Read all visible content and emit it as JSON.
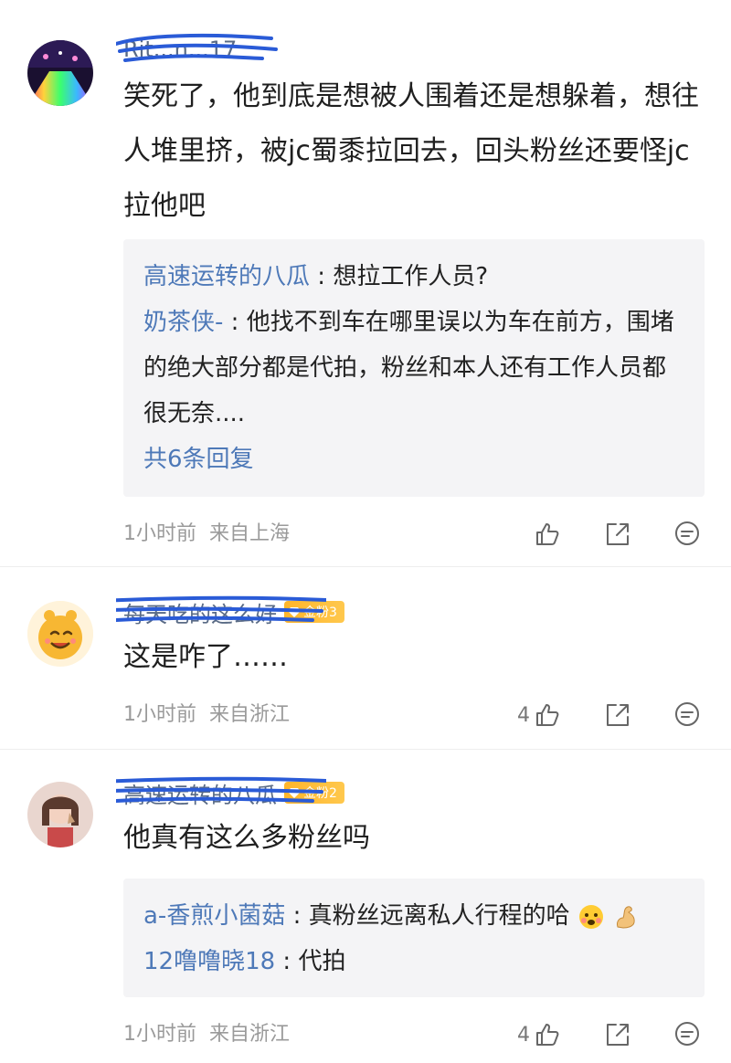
{
  "comments": [
    {
      "name": "Rit...n...17",
      "text": "笑死了，他到底是想被人围着还是想躲着，想往人堆里挤，被jc蜀黍拉回去，回头粉丝还要怪jc拉他吧",
      "replies": [
        {
          "name": "高速运转的八瓜",
          "text": "想拉工作人员?"
        },
        {
          "name": "奶茶侠-",
          "text": "他找不到车在哪里误以为车在前方，围堵的绝大部分都是代拍，粉丝和本人还有工作人员都很无奈...."
        }
      ],
      "more_replies": "共6条回复",
      "time": "1小时前",
      "location": "来自上海",
      "likes": ""
    },
    {
      "name": "每天吃的这么好",
      "badge": "金粉3",
      "text": "这是咋了……",
      "time": "1小时前",
      "location": "来自浙江",
      "likes": "4"
    },
    {
      "name": "高速运转的八瓜",
      "badge": "金粉2",
      "text": "他真有这么多粉丝吗",
      "replies": [
        {
          "name": "a-香煎小菌菇",
          "text": "真粉丝远离私人行程的哈"
        },
        {
          "name": "12噜噜晓18",
          "text": "代拍"
        }
      ],
      "time": "1小时前",
      "location": "来自浙江",
      "likes": "4"
    }
  ],
  "icons": {
    "like": "thumb-up-icon",
    "share": "share-icon",
    "reply": "comment-icon",
    "badge": "gem-icon"
  },
  "colors": {
    "name": "#5a6b85",
    "reply_name": "#4e79b8",
    "badge": "#ffb52a",
    "scribble": "#2a5bd7"
  }
}
